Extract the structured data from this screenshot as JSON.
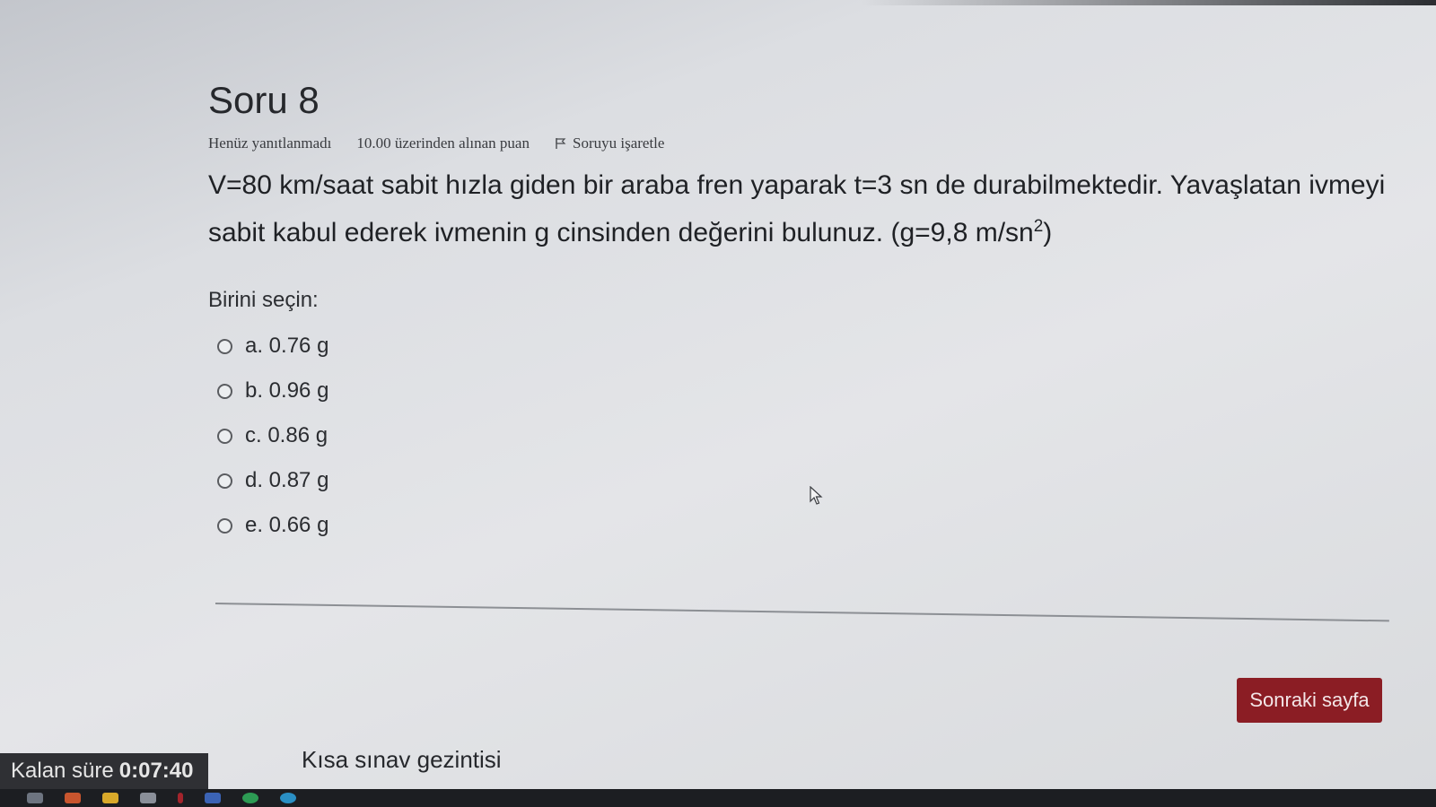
{
  "question": {
    "title": "Soru 8",
    "status": "Henüz yanıtlanmadı",
    "points": "10.00 üzerinden alınan puan",
    "flag_label": "Soruyu işaretle",
    "text_part1": "V=80 km/saat sabit hızla giden bir araba fren yaparak t=3 sn de durabilmektedir. Yavaşlatan ivmeyi sabit kabul ederek ivmenin g cinsinden değerini bulunuz. (g=9,8 m/sn",
    "text_sup": "2",
    "text_part2": ")",
    "prompt": "Birini seçin:",
    "options": [
      {
        "label": "a. 0.76 g"
      },
      {
        "label": "b. 0.96 g"
      },
      {
        "label": "c. 0.86 g"
      },
      {
        "label": "d. 0.87 g"
      },
      {
        "label": "e. 0.66 g"
      }
    ]
  },
  "footer": {
    "next_label": "Sonraki sayfa",
    "nav_label": "Kısa sınav gezintisi",
    "timer_label": "Kalan süre",
    "timer_value": "0:07:40"
  },
  "colors": {
    "next_button": "#8b1d24",
    "timer_bg": "#2f3034"
  }
}
